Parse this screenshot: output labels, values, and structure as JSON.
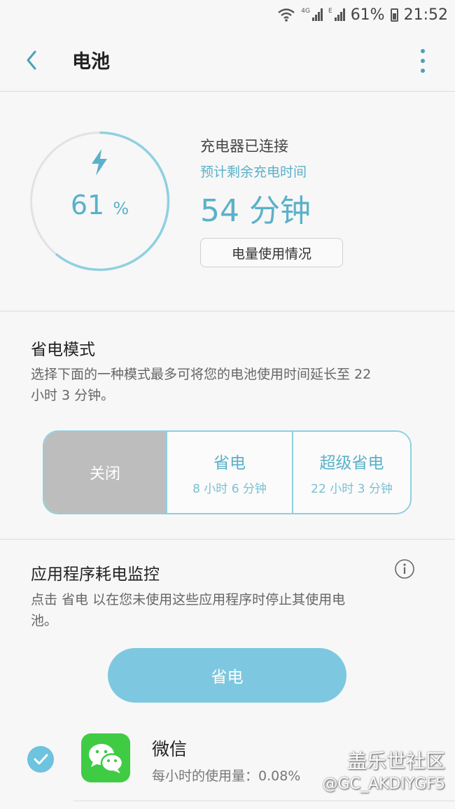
{
  "status_bar": {
    "network": "4G",
    "signal_label": "E",
    "battery_percent": "61%",
    "time": "21:52"
  },
  "app_bar": {
    "title": "电池"
  },
  "charging": {
    "percent": "61",
    "percent_unit": "%",
    "level": 0.61,
    "status": "充电器已连接",
    "estimate_label": "预计剩余充电时间",
    "time_remaining": "54 分钟",
    "usage_button": "电量使用情况"
  },
  "power_saving": {
    "title": "省电模式",
    "description": "选择下面的一种模式最多可将您的电池使用时间延长至 22 小时 3 分钟。",
    "options": [
      {
        "label": "关闭",
        "sub": ""
      },
      {
        "label": "省电",
        "sub": "8 小时 6 分钟"
      },
      {
        "label": "超级省电",
        "sub": "22 小时 3 分钟"
      }
    ]
  },
  "app_monitor": {
    "title": "应用程序耗电监控",
    "description": "点击 省电 以在您未使用这些应用程序时停止其使用电池。",
    "save_button": "省电",
    "apps": [
      {
        "name": "微信",
        "usage": "每小时的使用量：0.08%"
      }
    ]
  },
  "watermark": {
    "line1": "盖乐世社区",
    "line2": "@GC_AKDIYGF5"
  },
  "colors": {
    "accent": "#5ab1c9",
    "button": "#7dc8e0",
    "off_segment": "#bdbdbd",
    "wechat": "#3fcc44"
  }
}
